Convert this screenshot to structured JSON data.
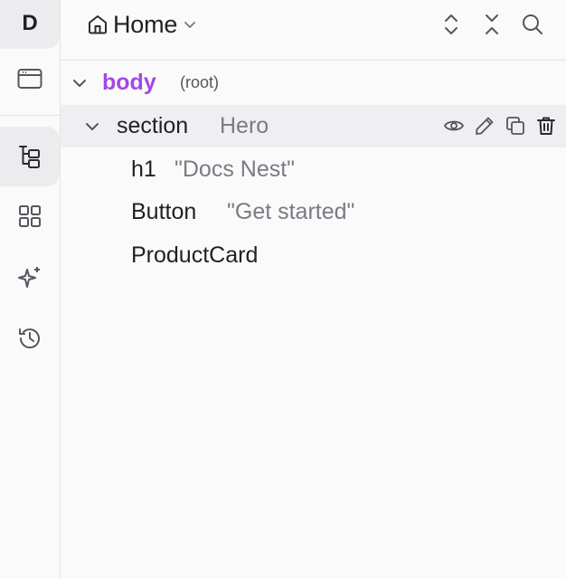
{
  "rail": {
    "avatar_letter": "D",
    "items": [
      {
        "name": "browser-window-icon"
      },
      {
        "name": "layers-tree-icon",
        "active": true
      },
      {
        "name": "grid-components-icon"
      },
      {
        "name": "sparkles-ai-icon"
      },
      {
        "name": "history-icon"
      }
    ]
  },
  "header": {
    "title": "Home"
  },
  "tree": {
    "nodes": [
      {
        "name": "body",
        "sub": "(root)"
      },
      {
        "name": "section",
        "sub": "Hero"
      },
      {
        "name": "h1",
        "sub": "\"Docs Nest\""
      },
      {
        "name": "Button",
        "sub": "\"Get started\""
      },
      {
        "name": "ProductCard",
        "sub": ""
      }
    ]
  },
  "colors": {
    "root_accent": "#a546e8",
    "selected_row_bg": "#efeff1",
    "muted_text": "#7a7b83"
  }
}
